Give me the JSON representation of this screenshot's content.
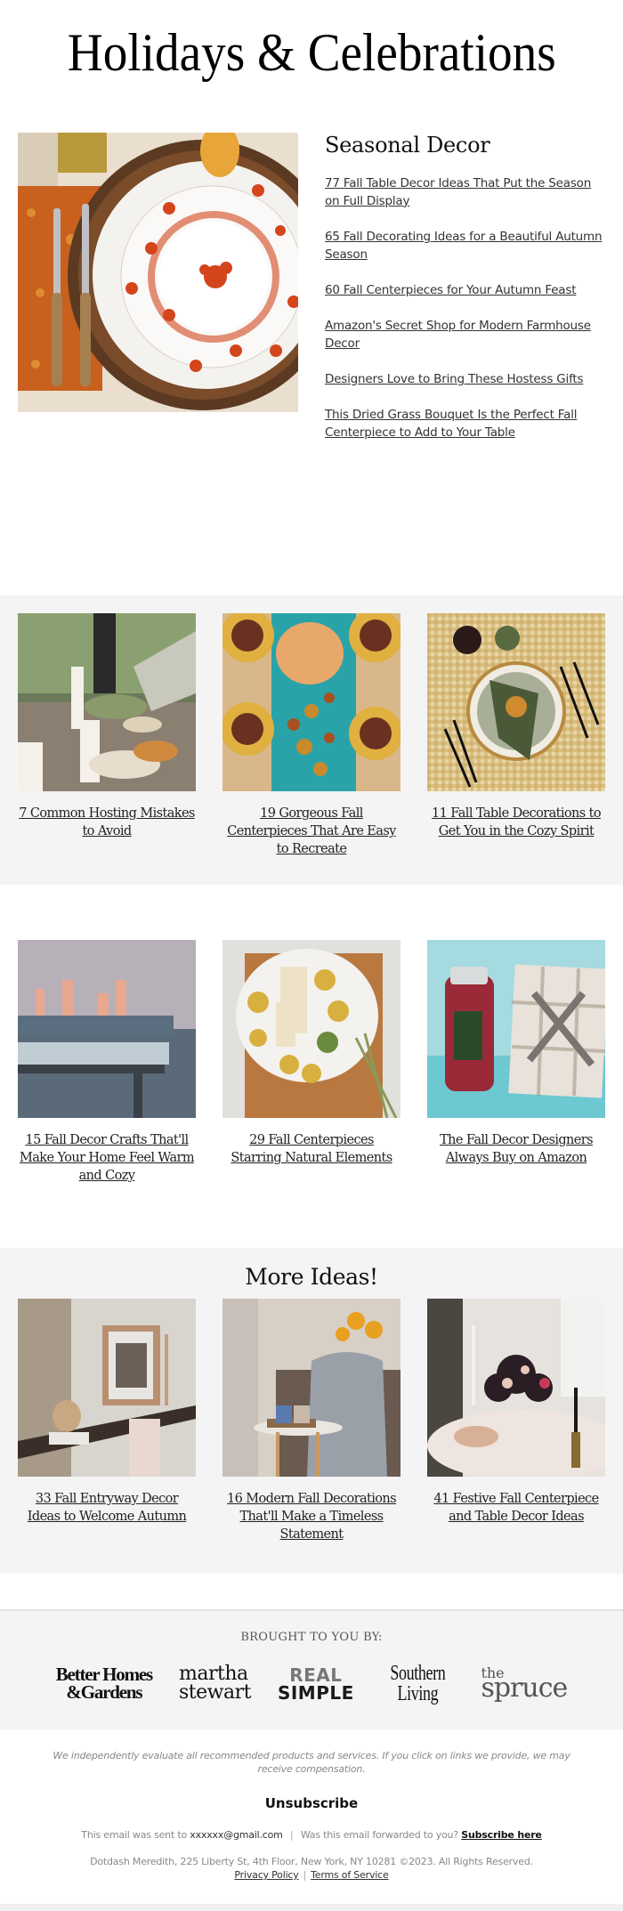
{
  "header": {
    "title": "Holidays & Celebrations"
  },
  "hero": {
    "image_alt": "Fall table setting with floral china plate, rattan charger and forks on orange napkin",
    "heading": "Seasonal Decor",
    "links": [
      "77 Fall Table Decor Ideas That Put the Season on Full Display",
      "65 Fall Decorating Ideas for a Beautiful Autumn Season",
      "60 Fall Centerpieces for Your Autumn Feast",
      "Amazon's Secret Shop for Modern Farmhouse Decor",
      "Designers Love to Bring These Hostess Gifts",
      "This Dried Grass Bouquet Is the Perfect Fall Centerpiece to Add to Your Table"
    ]
  },
  "section1": {
    "cards": [
      {
        "caption": "7 Common Hosting Mistakes to Avoid",
        "image_alt": "Outdoor dinner table with candles and serving bowls"
      },
      {
        "caption": "19 Gorgeous Fall Centerpieces That Are Easy to Recreate",
        "image_alt": "Teal table runner with pumpkin and autumn leaves"
      },
      {
        "caption": "11 Fall Table Decorations to Get You in the Cozy Spirit",
        "image_alt": "Gingham tablecloth with green napkin and dried orange"
      }
    ]
  },
  "section2": {
    "cards": [
      {
        "caption": "15 Fall Decor Crafts That'll Make Your Home Feel Warm and Cozy",
        "image_alt": "Rustic table with lanterns and bench"
      },
      {
        "caption": "29 Fall Centerpieces Starring Natural Elements",
        "image_alt": "Platter with candles and gourds on cutting board"
      },
      {
        "caption": "The Fall Decor Designers Always Buy on Amazon",
        "image_alt": "Yankee candle jar and plaid blanket with bow"
      }
    ]
  },
  "section3": {
    "heading": "More Ideas!",
    "cards": [
      {
        "caption": "33 Fall Entryway Decor Ideas to Welcome Autumn",
        "image_alt": "Entry console with framed print and dried grasses"
      },
      {
        "caption": "16 Modern Fall Decorations That'll Make a Timeless Statement",
        "image_alt": "Side table with mugs, candle and throw blanket"
      },
      {
        "caption": "41 Festive Fall Centerpiece and Table Decor Ideas",
        "image_alt": "Dark floral centerpiece with taper candles"
      }
    ]
  },
  "brands": {
    "label": "BROUGHT TO YOU BY:",
    "logos": {
      "bhg": [
        "Better Homes",
        "&Gardens"
      ],
      "martha": [
        "martha",
        "stewart"
      ],
      "realsimple": [
        "REAL",
        "SIMPLE"
      ],
      "southern": [
        "Southern",
        "Living"
      ],
      "spruce": [
        "the",
        "spruce"
      ]
    }
  },
  "footer": {
    "disclaimer": "We independently evaluate all recommended products and services. If you click on links we provide, we may receive compensation.",
    "unsubscribe": "Unsubscribe",
    "sent_prefix": "This email was sent to ",
    "email": "xxxxxx@gmail.com",
    "separator": "|",
    "forwarded": "Was this email forwarded to you? ",
    "subscribe": "Subscribe here",
    "address": "Dotdash Meredith, 225 Liberty St, 4th Floor, New York, NY 10281 ©2023. All Rights Reserved.",
    "privacy": "Privacy Policy",
    "terms": "Terms of Service"
  }
}
